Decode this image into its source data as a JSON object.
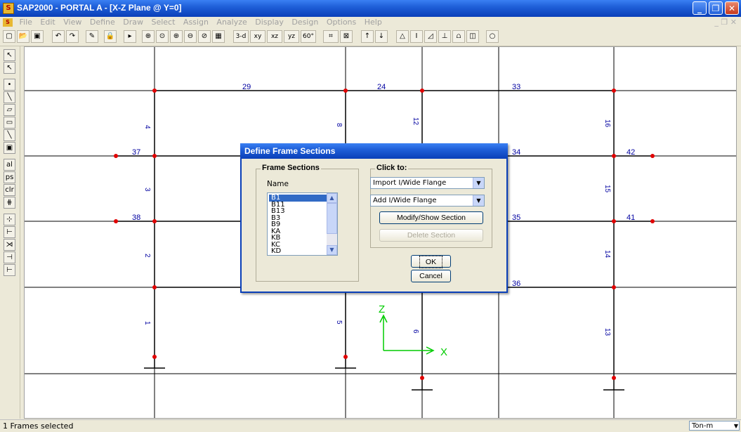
{
  "window": {
    "title": "SAP2000 - PORTAL A - [X-Z Plane @ Y=0]"
  },
  "menu": [
    "File",
    "Edit",
    "View",
    "Define",
    "Draw",
    "Select",
    "Assign",
    "Analyze",
    "Display",
    "Design",
    "Options",
    "Help"
  ],
  "toolbar": {
    "btn_3d": "3-d",
    "btn_xy": "xy",
    "btn_xz": "xz",
    "btn_yz": "yz",
    "btn_60": "60°"
  },
  "frame_labels": {
    "f1": "1",
    "f2": "2",
    "f3": "3",
    "f4": "4",
    "f5": "5",
    "f6": "6",
    "f8": "8",
    "f12": "12",
    "f13": "13",
    "f14": "14",
    "f15": "15",
    "f16": "16",
    "f24": "24",
    "f29": "29",
    "f33": "33",
    "f34": "34",
    "f35": "35",
    "f36": "36",
    "f37": "37",
    "f38": "38",
    "f41": "41",
    "f42": "42"
  },
  "axes": {
    "z": "Z",
    "x": "X"
  },
  "dialog": {
    "title": "Define Frame Sections",
    "frame_sections_label": "Frame Sections",
    "name_label": "Name",
    "sections": [
      "B1",
      "B11",
      "B13",
      "B3",
      "B9",
      "KA",
      "KB",
      "KC",
      "KD"
    ],
    "selected": "B1",
    "click_to_label": "Click to:",
    "import_combo": "Import I/Wide Flange",
    "add_combo": "Add I/Wide Flange",
    "modify_button": "Modify/Show Section",
    "delete_button": "Delete Section",
    "ok_button": "OK",
    "cancel_button": "Cancel"
  },
  "status": {
    "text": "1 Frames selected",
    "units": "Ton-m"
  },
  "colors": {
    "titlebar": "#0a3fb8",
    "frame_line": "#000000",
    "joint": "#e00000",
    "label": "#0000a0",
    "axis": "#00cc00"
  }
}
